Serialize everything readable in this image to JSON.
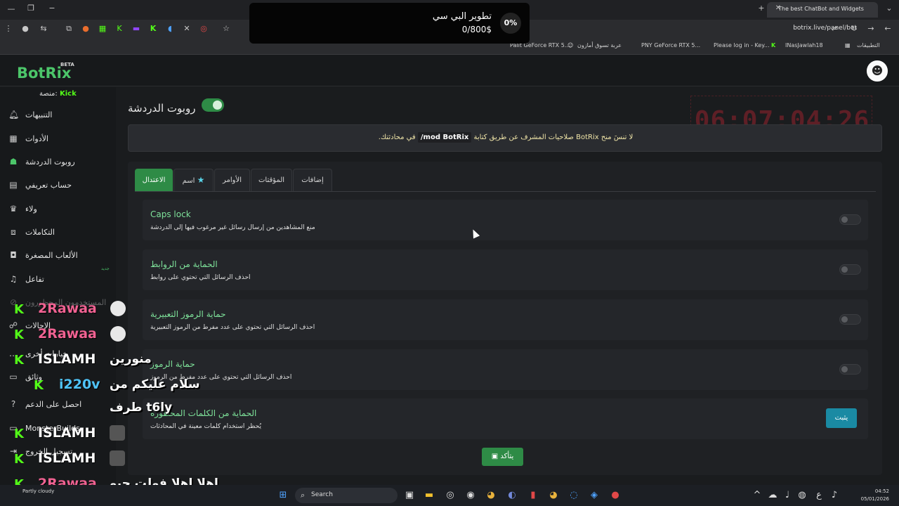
{
  "browser": {
    "tab_title": "The best ChatBot and Widgets",
    "url": "botrix.live/panel/bot",
    "bookmarks": [
      "Palit GeForce RTX 5...",
      "عربة تسوق أمازون",
      "PNY GeForce RTX 5...",
      "Please log in - Key...",
      "INasJawlah18",
      "التطبيقات"
    ]
  },
  "donation": {
    "title": "تطوير البي سي",
    "amount": "0/800$",
    "percent": "0%"
  },
  "app": {
    "logo": "BotRix",
    "beta": "BETA"
  },
  "sidebar": {
    "platform_label": "منصة:",
    "platform_value": "Kick",
    "new_badge": "جديد",
    "items": [
      {
        "label": "التنبيهات",
        "icon": "bell-icon"
      },
      {
        "label": "الأدوات",
        "icon": "widgets-icon"
      },
      {
        "label": "روبوت الدردشة",
        "icon": "robot-icon"
      },
      {
        "label": "حساب تعريفي",
        "icon": "id-card-icon"
      },
      {
        "label": "ولاء",
        "icon": "trophy-icon"
      },
      {
        "label": "التكاملات",
        "icon": "integration-icon"
      },
      {
        "label": "الألعاب المصغرة",
        "icon": "gamepad-icon"
      },
      {
        "label": "تفاعل",
        "icon": "music-icon"
      },
      {
        "label": "المستخدمون المحظورون",
        "icon": "ban-icon"
      },
      {
        "label": "الإحالات",
        "icon": "users-icon"
      },
      {
        "label": "خيارات أخرى",
        "icon": "more-icon"
      },
      {
        "label": "وثائق",
        "icon": "doc-icon"
      },
      {
        "label": "احصل على الدعم",
        "icon": "help-icon"
      },
      {
        "label": "MonsterBuilds",
        "icon": "monitor-icon"
      },
      {
        "label": "تسجيل الخروج",
        "icon": "logout-icon"
      }
    ]
  },
  "main": {
    "title": "روبوت الدردشة",
    "timer": "06:07:04:26",
    "alert_prefix": "في محادثتك.",
    "alert_code": "/mod BotRix",
    "alert_suffix": "لا تنسَ منح BotRix صلاحيات المشرف عن طريق كتابة",
    "tabs": [
      "الاعتدال",
      "اسم",
      "الأوامر",
      "المؤقتات",
      "إضافات"
    ],
    "cards": [
      {
        "title": "Caps lock",
        "desc": "منع المشاهدين من إرسال رسائل غير مرغوب فيها إلى الدردشة"
      },
      {
        "title": "الحماية من الروابط",
        "desc": "احذف الرسائل التي تحتوي على روابط"
      },
      {
        "title": "حماية الرموز التعبيرية",
        "desc": "احذف الرسائل التي تحتوي على عدد مفرط من الرموز التعبيرية"
      },
      {
        "title": "حماية الرموز",
        "desc": "احذف الرسائل التي تحتوي على عدد مفرط من الرموز"
      },
      {
        "title": "الحماية من الكلمات المحظورة",
        "desc": "يُحظر استخدام كلمات معينة في المحادثات",
        "button": "يثبت"
      }
    ],
    "confirm": "يتأكد"
  },
  "chat_overlay": [
    {
      "user": "2Rawaa",
      "color": "#f06292",
      "msg": ""
    },
    {
      "user": "2Rawaa",
      "color": "#f06292",
      "msg": ""
    },
    {
      "user": "ISLAMH",
      "color": "#ffffff",
      "msg": "منورين"
    },
    {
      "user": "i220v",
      "color": "#4fc3f7",
      "msg": "سلام عليكم من"
    },
    {
      "user": "",
      "color": "#ffffff",
      "msg": "طرف t6ly"
    },
    {
      "user": "ISLAMH",
      "color": "#ffffff",
      "msg": ""
    },
    {
      "user": "ISLAMH",
      "color": "#ffffff",
      "msg": ""
    },
    {
      "user": "2Rawaa",
      "color": "#f06292",
      "msg": "اهلا اهلا فولت حيو"
    }
  ],
  "taskbar": {
    "search": "Search",
    "weather": "Partly cloudy",
    "time": "04:52",
    "date": "05/01/2026"
  }
}
